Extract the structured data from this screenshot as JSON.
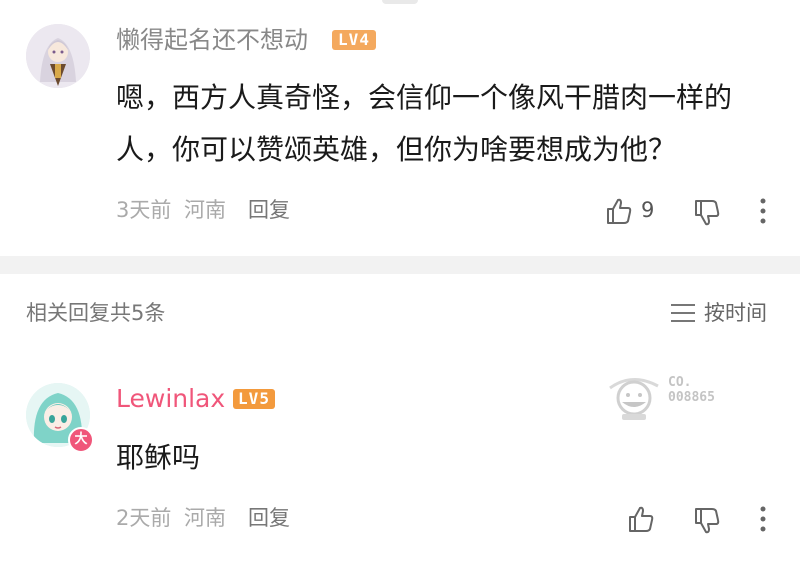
{
  "comment": {
    "username": "懒得起名还不想动",
    "level_badge": "LV4",
    "text": "嗯，西方人真奇怪，会信仰一个像风干腊肉一样的人，你可以赞颂英雄，但你为啥要想成为他？",
    "time": "3天前",
    "location": "河南",
    "reply_label": "回复",
    "like_count": "9"
  },
  "replies_section": {
    "title": "相关回复共5条",
    "sort_label": "按时间"
  },
  "reply": {
    "username": "Lewinlax",
    "level_badge": "LV5",
    "avatar_badge": "大",
    "text": "耶稣吗",
    "time": "2天前",
    "location": "河南",
    "reply_label": "回复"
  },
  "watermark": {
    "line1": "CO.",
    "line2": "008865"
  },
  "colors": {
    "accent_pink": "#f0567a",
    "level4_badge": "#f4a95e",
    "level5_badge": "#f39a3d",
    "meta_gray": "#aaaaaa"
  }
}
